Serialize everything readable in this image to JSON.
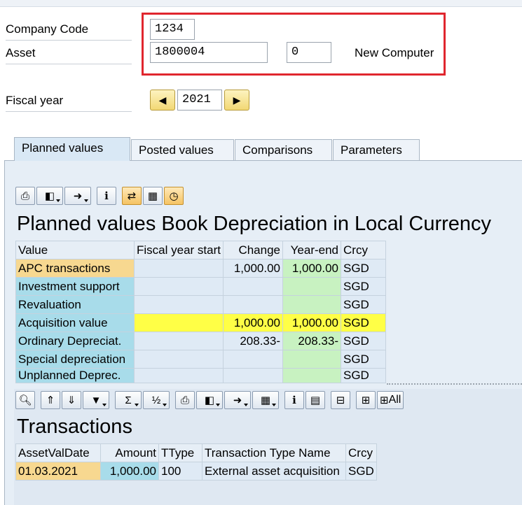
{
  "header": {
    "company_code_label": "Company Code",
    "company_code_value": "1234",
    "asset_label": "Asset",
    "asset_value": "1800004",
    "sub_number_value": "0",
    "asset_description": "New Computer",
    "fiscal_year_label": "Fiscal year",
    "fiscal_year_value": "2021"
  },
  "tabs": [
    {
      "label": "Planned values",
      "active": true
    },
    {
      "label": "Posted values",
      "active": false
    },
    {
      "label": "Comparisons",
      "active": false
    },
    {
      "label": "Parameters",
      "active": false
    }
  ],
  "planned": {
    "title": "Planned values Book Depreciation in Local Currency",
    "columns": [
      "Value",
      "Fiscal year start",
      "Change",
      "Year-end",
      "Crcy"
    ],
    "rows": [
      {
        "name": "APC transactions",
        "start": "",
        "change": "1,000.00",
        "end": "1,000.00",
        "crcy": "SGD"
      },
      {
        "name": "Investment support",
        "start": "",
        "change": "",
        "end": "",
        "crcy": "SGD"
      },
      {
        "name": "Revaluation",
        "start": "",
        "change": "",
        "end": "",
        "crcy": "SGD"
      },
      {
        "name": "Acquisition value",
        "start": "",
        "change": "1,000.00",
        "end": "1,000.00",
        "crcy": "SGD"
      },
      {
        "name": "Ordinary Depreciat.",
        "start": "",
        "change": "208.33-",
        "end": "208.33-",
        "crcy": "SGD"
      },
      {
        "name": "Special depreciation",
        "start": "",
        "change": "",
        "end": "",
        "crcy": "SGD"
      },
      {
        "name": "Unplanned Deprec.",
        "start": "",
        "change": "",
        "end": "",
        "crcy": "SGD"
      }
    ]
  },
  "transactions": {
    "title": "Transactions",
    "toolbar_all_label": "All",
    "columns": [
      "AssetValDate",
      "Amount",
      "TType",
      "Transaction Type Name",
      "Crcy"
    ],
    "rows": [
      {
        "date": "01.03.2021",
        "amount": "1,000.00",
        "ttype": "100",
        "name": "External asset acquisition",
        "crcy": "SGD"
      }
    ]
  },
  "colors": {
    "highlight_box": "#e0262e",
    "yellow_row": "#ffff46",
    "green_cell": "#c8f2c1",
    "name_cell": "#a8dcea",
    "selected_name": "#f7d890"
  }
}
